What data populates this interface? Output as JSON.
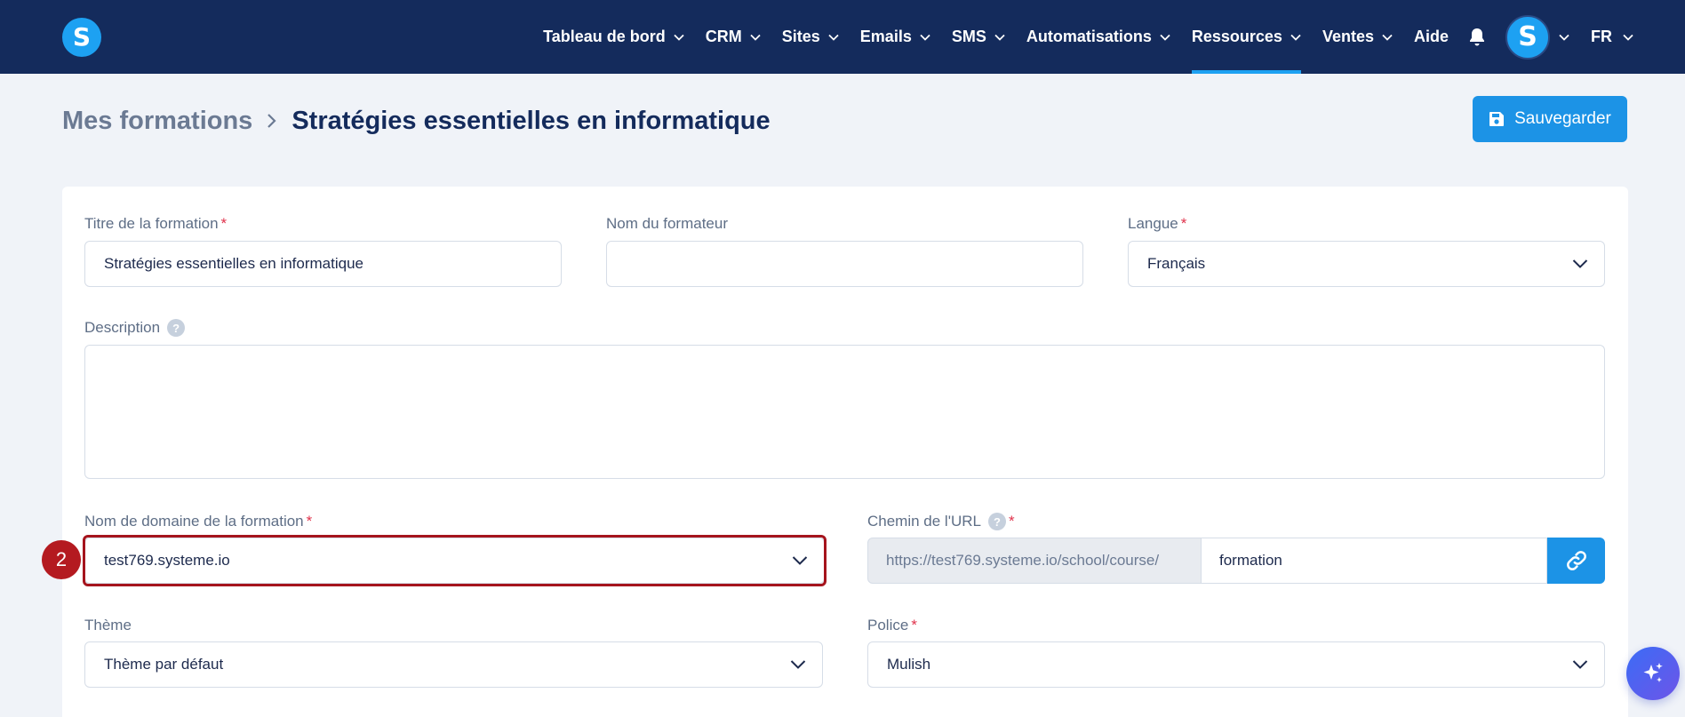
{
  "nav": {
    "items": [
      {
        "label": "Tableau de bord"
      },
      {
        "label": "CRM"
      },
      {
        "label": "Sites"
      },
      {
        "label": "Emails"
      },
      {
        "label": "SMS"
      },
      {
        "label": "Automatisations"
      },
      {
        "label": "Ressources",
        "active": true
      },
      {
        "label": "Ventes"
      }
    ],
    "help_label": "Aide",
    "language": "FR",
    "logo_letter": "S",
    "avatar_letter": "S"
  },
  "breadcrumb": {
    "root": "Mes formations",
    "current": "Stratégies essentielles en informatique"
  },
  "actions": {
    "save_label": "Sauvegarder"
  },
  "form": {
    "title_label": "Titre de la formation",
    "title_value": "Stratégies essentielles en informatique",
    "author_label": "Nom du formateur",
    "author_value": "",
    "language_label": "Langue",
    "language_value": "Français",
    "description_label": "Description",
    "description_value": "",
    "domain_label": "Nom de domaine de la formation",
    "domain_value": "test769.systeme.io",
    "url_path_label": "Chemin de l'URL",
    "url_prefix": "https://test769.systeme.io/school/course/",
    "url_path_value": "formation",
    "theme_label": "Thème",
    "theme_value": "Thème par défaut",
    "font_label": "Police",
    "font_value": "Mulish",
    "required_mark": "*",
    "help_mark": "?"
  },
  "annotation": {
    "step_number": "2"
  },
  "colors": {
    "nav_bg": "#142b5c",
    "accent": "#1c93e6",
    "highlight": "#a5141d",
    "required": "#e0324b"
  }
}
